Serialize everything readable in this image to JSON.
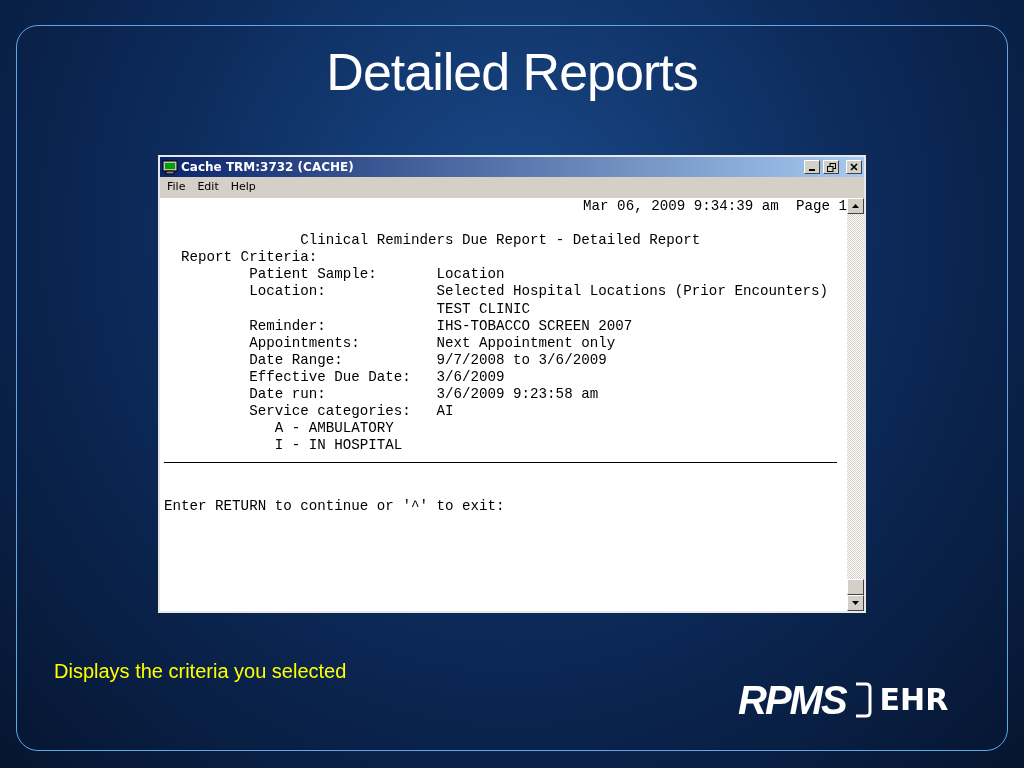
{
  "slide": {
    "title": "Detailed Reports",
    "caption": "Displays the criteria you selected",
    "logo": {
      "main": "RPMS",
      "suffix": "EHR"
    }
  },
  "window": {
    "title": "Cache TRM:3732 (CACHE)",
    "menu": [
      "File",
      "Edit",
      "Help"
    ],
    "terminal": {
      "timestamp": "Mar 06, 2009 9:34:39 am",
      "page": "Page 1",
      "report_title": "Clinical Reminders Due Report - Detailed Report",
      "criteria_heading": "Report Criteria:",
      "criteria": [
        {
          "label": "Patient Sample:",
          "values": [
            "Location"
          ]
        },
        {
          "label": "Location:",
          "values": [
            "Selected Hospital Locations (Prior Encounters)",
            "TEST CLINIC"
          ]
        },
        {
          "label": "Reminder:",
          "values": [
            "IHS-TOBACCO SCREEN 2007"
          ]
        },
        {
          "label": "Appointments:",
          "values": [
            "Next Appointment only"
          ]
        },
        {
          "label": "Date Range:",
          "values": [
            "9/7/2008 to 3/6/2009"
          ]
        },
        {
          "label": "Effective Due Date:",
          "values": [
            "3/6/2009"
          ]
        },
        {
          "label": "Date run:",
          "values": [
            "3/6/2009 9:23:58 am"
          ]
        },
        {
          "label": "Service categories:",
          "values": [
            "AI"
          ],
          "sub_items": [
            "A - AMBULATORY",
            "I - IN HOSPITAL"
          ]
        }
      ],
      "prompt": "Enter RETURN to continue or '^' to exit:"
    }
  }
}
